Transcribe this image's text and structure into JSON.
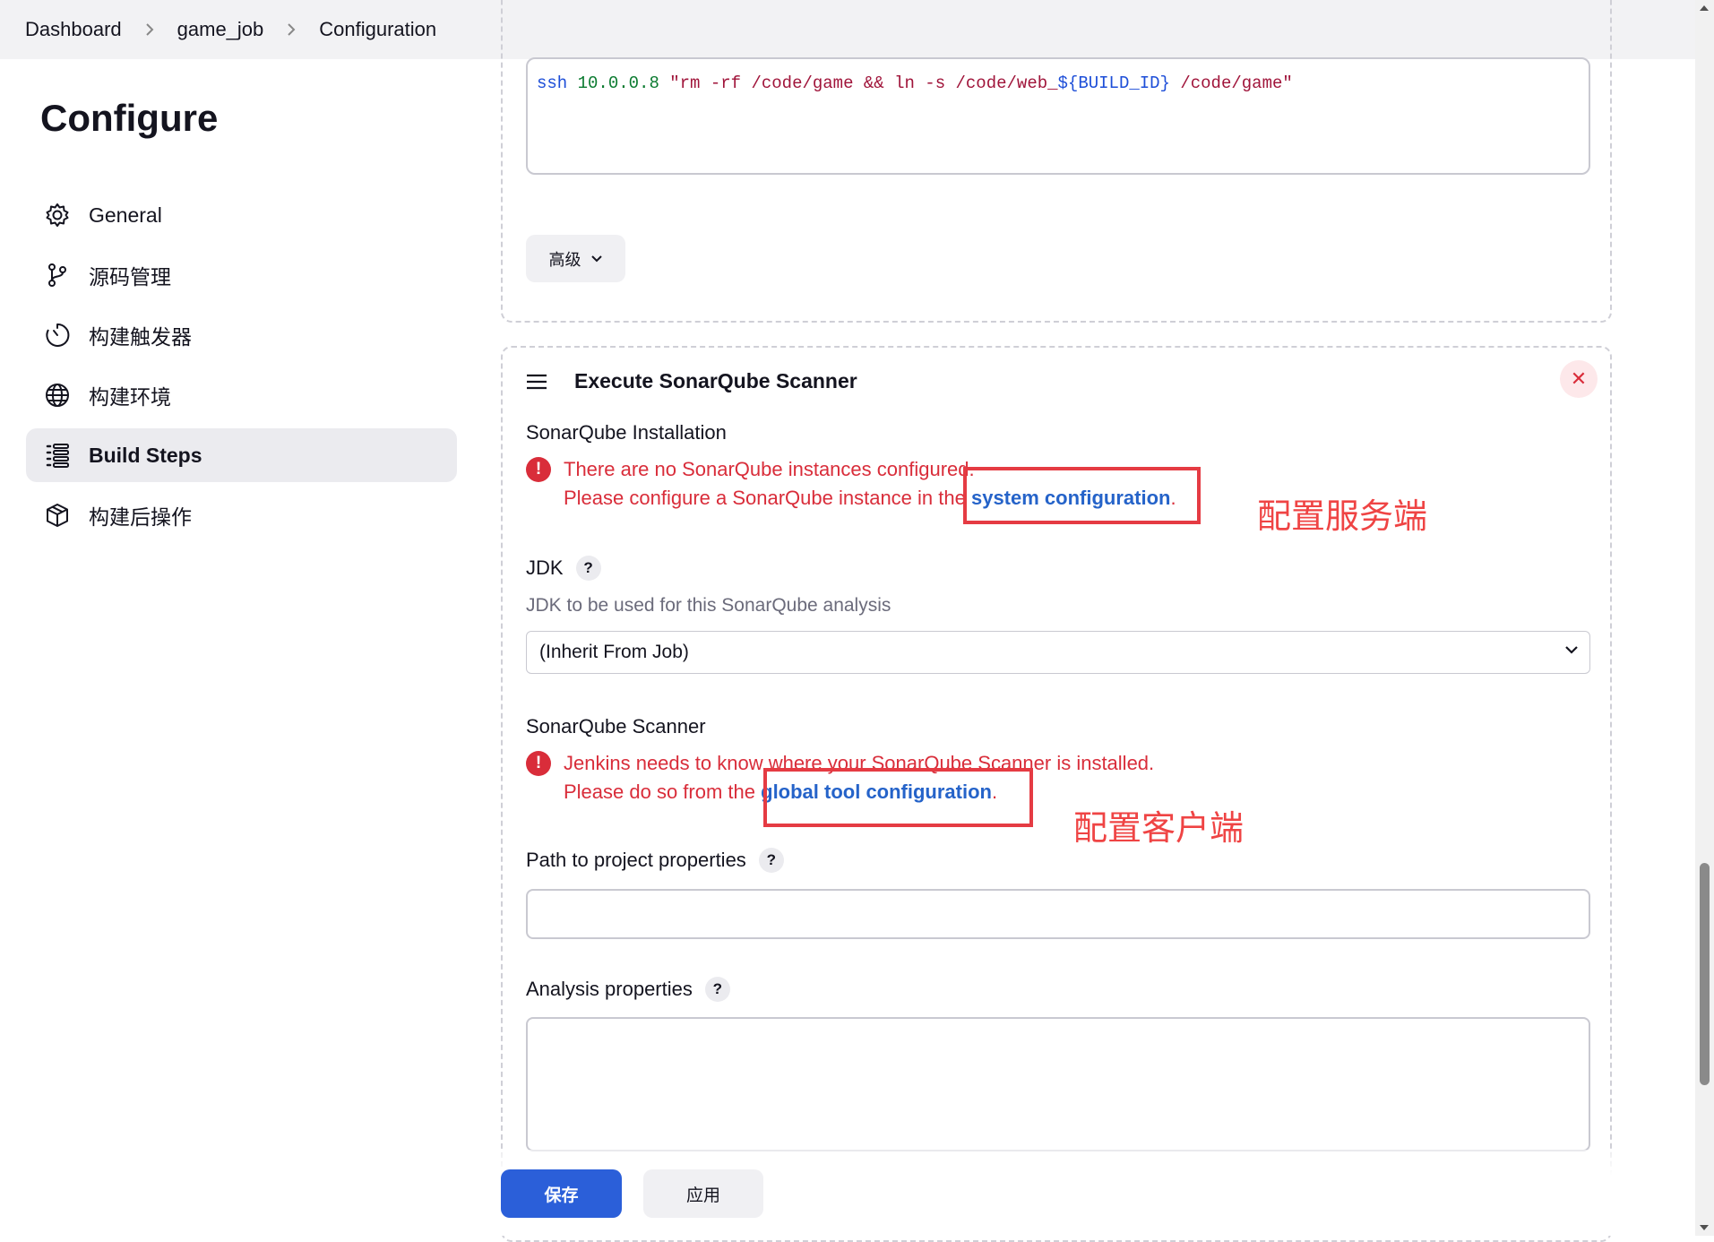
{
  "breadcrumb": {
    "items": [
      "Dashboard",
      "game_job",
      "Configuration"
    ]
  },
  "sidebar": {
    "title": "Configure",
    "items": [
      {
        "label": "General",
        "icon": "gear-icon"
      },
      {
        "label": "源码管理",
        "icon": "branch-icon"
      },
      {
        "label": "构建触发器",
        "icon": "clock-icon"
      },
      {
        "label": "构建环境",
        "icon": "globe-icon"
      },
      {
        "label": "Build Steps",
        "icon": "list-icon",
        "active": true
      },
      {
        "label": "构建后操作",
        "icon": "package-icon"
      }
    ]
  },
  "shell_step": {
    "code": {
      "cmd": "ssh",
      "host": "10.0.0.8",
      "str1": "\"rm -rf /code/game && ln -s /code/web_",
      "var": "${BUILD_ID}",
      "str2": " /code/game\""
    },
    "advanced_label": "高级"
  },
  "sonar_step": {
    "title": "Execute SonarQube Scanner",
    "installation_label": "SonarQube Installation",
    "installation_error_line1": "There are no SonarQube instances configured.",
    "installation_error_line2_prefix": "Please configure a SonarQube instance in the ",
    "installation_error_link": "system configuration",
    "installation_error_suffix": ".",
    "annotation_server": "配置服务端",
    "jdk_label": "JDK",
    "jdk_desc": "JDK to be used for this SonarQube analysis",
    "jdk_selected": "(Inherit From Job)",
    "scanner_label": "SonarQube Scanner",
    "scanner_error_line1": "Jenkins needs to know where your SonarQube Scanner is installed.",
    "scanner_error_line2_prefix": "Please do so from the ",
    "scanner_error_link": "global tool configuration",
    "scanner_error_suffix": ".",
    "annotation_client": "配置客户端",
    "path_label": "Path to project properties",
    "analysis_label": "Analysis properties"
  },
  "footer": {
    "save_label": "保存",
    "apply_label": "应用"
  },
  "colors": {
    "primary": "#2b5fd9",
    "error": "#d92d3a",
    "annotation": "#ef4444"
  }
}
